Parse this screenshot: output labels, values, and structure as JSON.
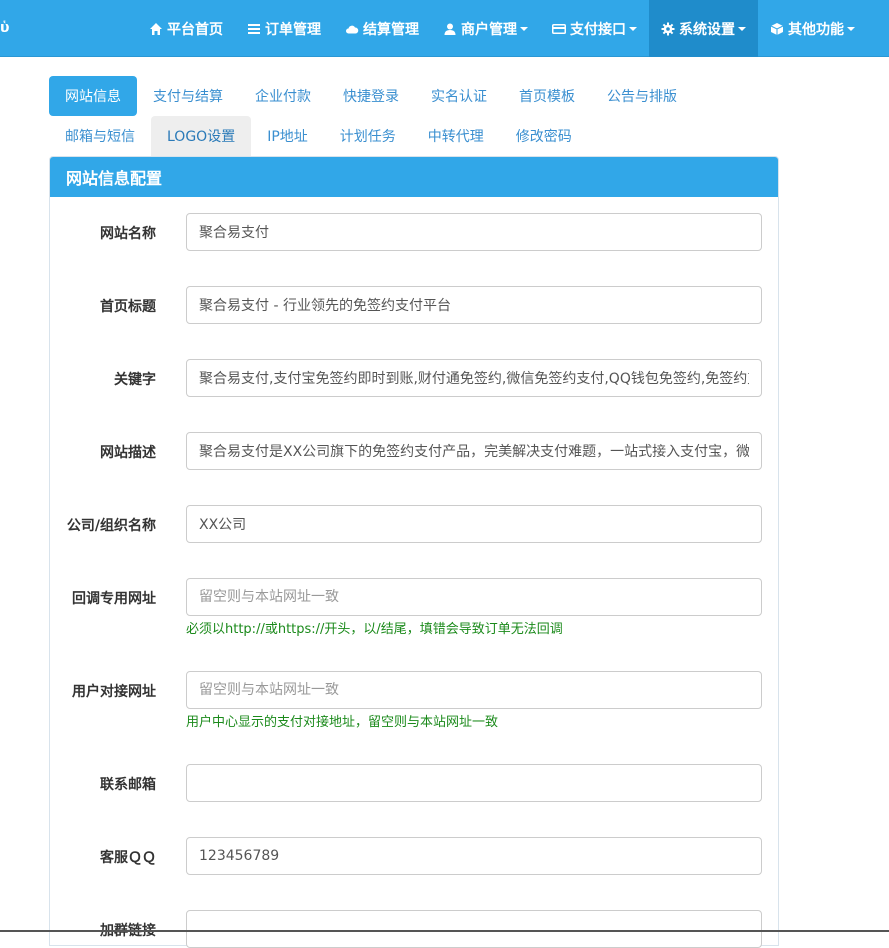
{
  "navbar": {
    "left_glyph": "ὑ",
    "items": [
      {
        "label": "平台首页",
        "icon": "home-icon",
        "dropdown": false,
        "active": false
      },
      {
        "label": "订单管理",
        "icon": "list-icon",
        "dropdown": false,
        "active": false
      },
      {
        "label": "结算管理",
        "icon": "cloud-icon",
        "dropdown": false,
        "active": false
      },
      {
        "label": "商户管理",
        "icon": "user-icon",
        "dropdown": true,
        "active": false
      },
      {
        "label": "支付接口",
        "icon": "credit-card-icon",
        "dropdown": true,
        "active": false
      },
      {
        "label": "系统设置",
        "icon": "gear-icon",
        "dropdown": true,
        "active": true
      },
      {
        "label": "其他功能",
        "icon": "cube-icon",
        "dropdown": true,
        "active": false
      }
    ],
    "bg_color": "#31a7e8",
    "active_color": "#1f8ccb"
  },
  "tabs": {
    "row1": [
      "网站信息",
      "支付与结算",
      "企业付款",
      "快捷登录",
      "实名认证",
      "首页模板",
      "公告与排版"
    ],
    "row2": [
      "邮箱与短信",
      "LOGO设置",
      "IP地址",
      "计划任务",
      "中转代理",
      "修改密码"
    ],
    "active": "网站信息",
    "hovered": "LOGO设置"
  },
  "panel": {
    "title": "网站信息配置"
  },
  "form": {
    "site_name": {
      "label": "网站名称",
      "value": "聚合易支付",
      "placeholder": ""
    },
    "home_title": {
      "label": "首页标题",
      "value": "聚合易支付 - 行业领先的免签约支付平台",
      "placeholder": ""
    },
    "keywords": {
      "label": "关键字",
      "value": "聚合易支付,支付宝免签约即时到账,财付通免签约,微信免签约支付,QQ钱包免签约,免签约支付",
      "placeholder": ""
    },
    "description": {
      "label": "网站描述",
      "value": "聚合易支付是XX公司旗下的免签约支付产品，完美解决支付难题，一站式接入支付宝，微信，财付通，QQ钱包",
      "placeholder": ""
    },
    "company": {
      "label": "公司/组织名称",
      "value": "XX公司",
      "placeholder": ""
    },
    "callback_url": {
      "label": "回调专用网址",
      "value": "",
      "placeholder": "留空则与本站网址一致",
      "help": "必须以http://或https://开头，以/结尾，填错会导致订单无法回调"
    },
    "api_url": {
      "label": "用户对接网址",
      "value": "",
      "placeholder": "留空则与本站网址一致",
      "help": "用户中心显示的支付对接地址，留空则与本站网址一致"
    },
    "email": {
      "label": "联系邮箱",
      "value": "",
      "placeholder": ""
    },
    "qq": {
      "label": "客服ＱＱ",
      "value": "123456789",
      "placeholder": ""
    },
    "group_link": {
      "label": "加群链接",
      "value": "",
      "placeholder": ""
    }
  }
}
